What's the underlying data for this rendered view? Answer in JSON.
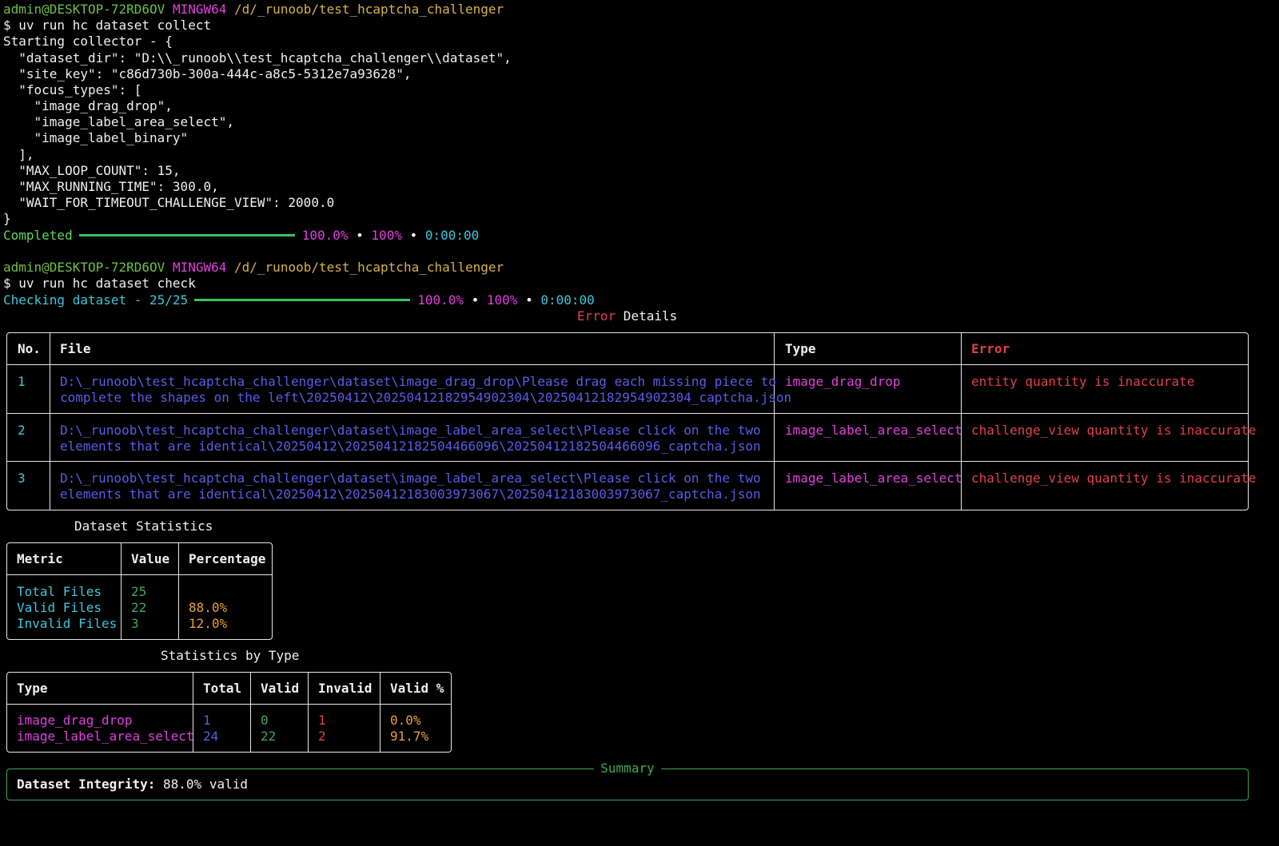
{
  "prompt": {
    "user_host": "admin@DESKTOP-72RD6OV",
    "shell": "MINGW64",
    "path": "/d/_runoob/test_hcaptcha_challenger"
  },
  "cmd1": "$ uv run hc dataset collect",
  "collector_output": [
    "Starting collector - {",
    "  \"dataset_dir\": \"D:\\\\_runoob\\\\test_hcaptcha_challenger\\\\dataset\",",
    "  \"site_key\": \"c86d730b-300a-444c-a8c5-5312e7a93628\",",
    "  \"focus_types\": [",
    "    \"image_drag_drop\",",
    "    \"image_label_area_select\",",
    "    \"image_label_binary\"",
    "  ],",
    "  \"MAX_LOOP_COUNT\": 15,",
    "  \"MAX_RUNNING_TIME\": 300.0,",
    "  \"WAIT_FOR_TIMEOUT_CHALLENGE_VIEW\": 2000.0",
    "}"
  ],
  "progress1": {
    "label": "Completed",
    "percent": "100.0%",
    "count": "100%",
    "time": "0:00:00",
    "dot": "•",
    "fill": 1.0
  },
  "cmd2": "$ uv run hc dataset check",
  "progress2": {
    "label": "Checking dataset - 25/25",
    "percent": "100.0%",
    "count": "100%",
    "time": "0:00:00",
    "dot": "•",
    "fill": 1.0
  },
  "error_table": {
    "title_red": "Error",
    "title_rest": " Details",
    "headers": {
      "no": "No.",
      "file": "File",
      "type": "Type",
      "error": "Error"
    },
    "rows": [
      {
        "no": "1",
        "file_l1": "D:\\_runoob\\test_hcaptcha_challenger\\dataset\\image_drag_drop\\Please drag each missing piece to",
        "file_l2": "complete the shapes on the left\\20250412\\20250412182954902304\\20250412182954902304_captcha.json",
        "type": "image_drag_drop",
        "error": "entity quantity is inaccurate"
      },
      {
        "no": "2",
        "file_l1": "D:\\_runoob\\test_hcaptcha_challenger\\dataset\\image_label_area_select\\Please click on the two",
        "file_l2": "elements that are identical\\20250412\\20250412182504466096\\20250412182504466096_captcha.json",
        "type": "image_label_area_select",
        "error": "challenge_view quantity is inaccurate"
      },
      {
        "no": "3",
        "file_l1": "D:\\_runoob\\test_hcaptcha_challenger\\dataset\\image_label_area_select\\Please click on the two",
        "file_l2": "elements that are identical\\20250412\\20250412183003973067\\20250412183003973067_captcha.json",
        "type": "image_label_area_select",
        "error": "challenge_view quantity is inaccurate"
      }
    ]
  },
  "dataset_stats": {
    "title": "Dataset Statistics",
    "headers": {
      "metric": "Metric",
      "value": "Value",
      "percentage": "Percentage"
    },
    "rows": [
      {
        "metric": "Total Files",
        "value": "25",
        "percentage": ""
      },
      {
        "metric": "Valid Files",
        "value": "22",
        "percentage": "88.0%"
      },
      {
        "metric": "Invalid Files",
        "value": "3",
        "percentage": "12.0%"
      }
    ]
  },
  "type_stats": {
    "title": "Statistics by Type",
    "headers": {
      "type": "Type",
      "total": "Total",
      "valid": "Valid",
      "invalid": "Invalid",
      "valid_pct": "Valid %"
    },
    "rows": [
      {
        "type": "image_drag_drop",
        "total": "1",
        "valid": "0",
        "invalid": "1",
        "valid_pct": "0.0%"
      },
      {
        "type": "image_label_area_select",
        "total": "24",
        "valid": "22",
        "invalid": "2",
        "valid_pct": "91.7%"
      }
    ]
  },
  "summary": {
    "label": "Summary",
    "integrity_label": "Dataset Integrity:",
    "integrity_value": " 88.0% valid"
  },
  "colors": {
    "background": "#000000",
    "prompt_user": "#6fbf4a",
    "prompt_shell": "#e040e0",
    "prompt_path": "#d7b24a",
    "progress_bar": "#3fbf5f",
    "file_path": "#5a5ce8",
    "error_text": "#e0404a",
    "type_text": "#e040e0",
    "percentage": "#e8a03a"
  }
}
